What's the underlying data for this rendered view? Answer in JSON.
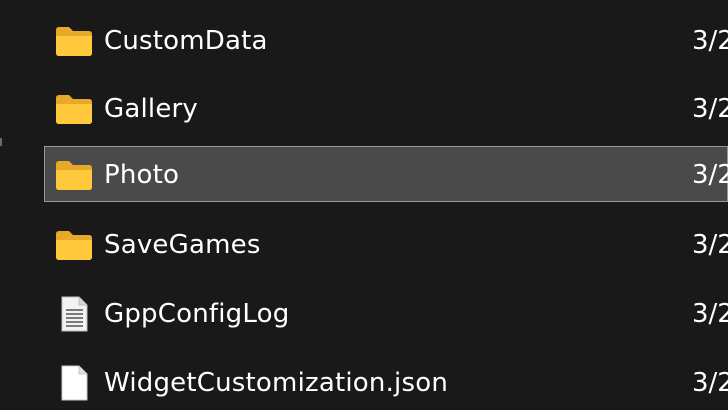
{
  "file_list": {
    "items": [
      {
        "name": "CustomData",
        "date": "3/2",
        "type": "folder",
        "icon": "folder-icon",
        "selected": false
      },
      {
        "name": "Gallery",
        "date": "3/2",
        "type": "folder",
        "icon": "folder-icon",
        "selected": false
      },
      {
        "name": "Photo",
        "date": "3/2",
        "type": "folder",
        "icon": "folder-icon",
        "selected": true
      },
      {
        "name": "SaveGames",
        "date": "3/2",
        "type": "folder",
        "icon": "folder-icon",
        "selected": false
      },
      {
        "name": "GppConfigLog",
        "date": "3/2",
        "type": "text-file",
        "icon": "text-file-icon",
        "selected": false
      },
      {
        "name": "WidgetCustomization.json",
        "date": "3/2",
        "type": "file",
        "icon": "blank-file-icon",
        "selected": false
      }
    ]
  },
  "colors": {
    "background": "#191919",
    "selected_row": "#4a4a4a",
    "selected_border": "#999999",
    "folder_yellow": "#ffc83d",
    "text": "#ffffff"
  }
}
